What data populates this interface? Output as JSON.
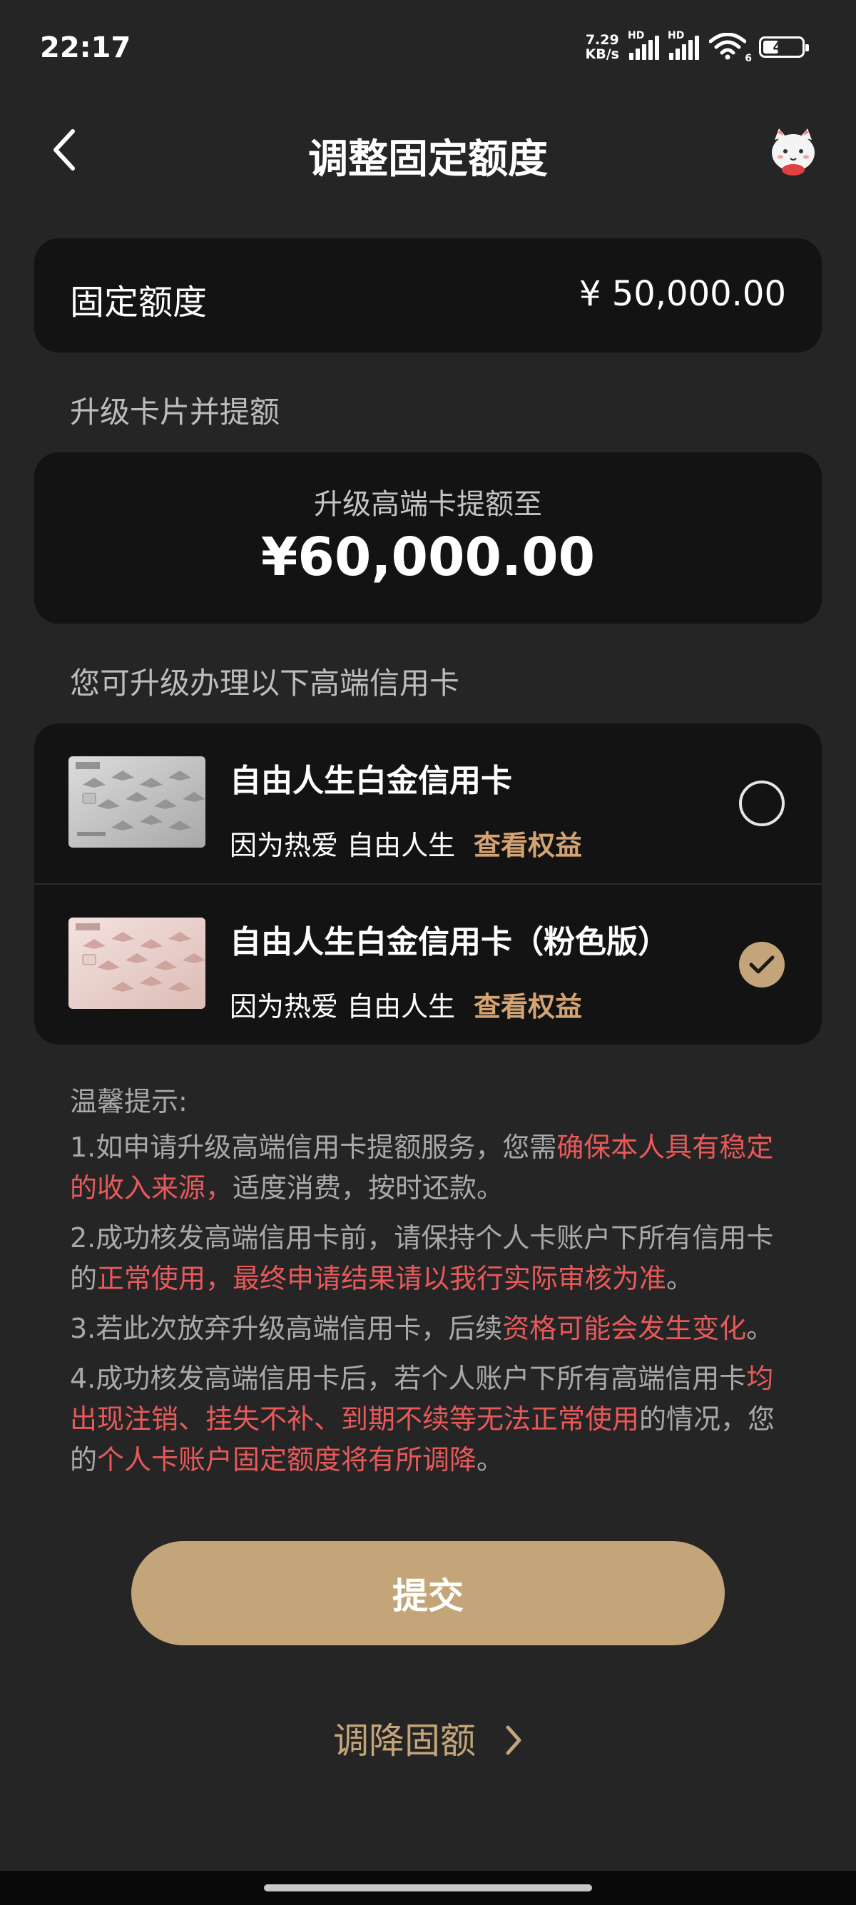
{
  "status_bar": {
    "time": "22:17",
    "net_speed_value": "7.29",
    "net_speed_unit": "KB/s",
    "signal_1_label": "HD",
    "signal_2_label": "HD",
    "wifi_label": "6",
    "battery_label": "41",
    "battery_percent": 41
  },
  "header": {
    "title": "调整固定额度"
  },
  "fixed_limit": {
    "label": "固定额度",
    "value": "¥ 50,000.00"
  },
  "upgrade_section": {
    "label": "升级卡片并提额",
    "subtitle": "升级高端卡提额至",
    "amount": "¥60,000.00"
  },
  "cards_section": {
    "label": "您可升级办理以下高端信用卡",
    "options": [
      {
        "name": "自由人生白金信用卡",
        "desc": "因为热爱 自由人生",
        "link": "查看权益",
        "selected": false
      },
      {
        "name": "自由人生白金信用卡（粉色版）",
        "desc": "因为热爱 自由人生",
        "link": "查看权益",
        "selected": true
      }
    ]
  },
  "tips": {
    "title": "温馨提示:",
    "items": [
      [
        {
          "text": "1.如申请升级高端信用卡提额服务，您需",
          "hl": false
        },
        {
          "text": "确保本人具有稳定的收入来源，",
          "hl": true
        },
        {
          "text": "适度消费，按时还款。",
          "hl": false
        }
      ],
      [
        {
          "text": "2.成功核发高端信用卡前，请保持个人卡账户下所有信用卡的",
          "hl": false
        },
        {
          "text": "正常使用，最终申请结果请以我行实际审核为准",
          "hl": true
        },
        {
          "text": "。",
          "hl": false
        }
      ],
      [
        {
          "text": "3.若此次放弃升级高端信用卡，后续",
          "hl": false
        },
        {
          "text": "资格可能会发生变化",
          "hl": true
        },
        {
          "text": "。",
          "hl": false
        }
      ],
      [
        {
          "text": "4.成功核发高端信用卡后，若个人账户下所有高端信用卡",
          "hl": false
        },
        {
          "text": "均出现注销、挂失不补、到期不续等无法正常使用",
          "hl": true
        },
        {
          "text": "的情况，您的",
          "hl": false
        },
        {
          "text": "个人卡账户固定额度将有所调降",
          "hl": true
        },
        {
          "text": "。",
          "hl": false
        }
      ]
    ]
  },
  "actions": {
    "submit_label": "提交",
    "lower_link_label": "调降固额"
  },
  "colors": {
    "background": "#252525",
    "card": "#131313",
    "accent": "#c4a57a",
    "link": "#d4a373",
    "highlight": "#e8595a",
    "muted_text": "#a9a9a9"
  },
  "icons": {
    "back": "chevron-left-icon",
    "mascot": "cat-mascot-icon",
    "wifi": "wifi-icon",
    "signal": "signal-icon",
    "battery": "battery-icon",
    "radio_unchecked": "radio-unchecked-icon",
    "radio_checked": "check-circle-icon",
    "chevron": "chevron-right-icon"
  }
}
